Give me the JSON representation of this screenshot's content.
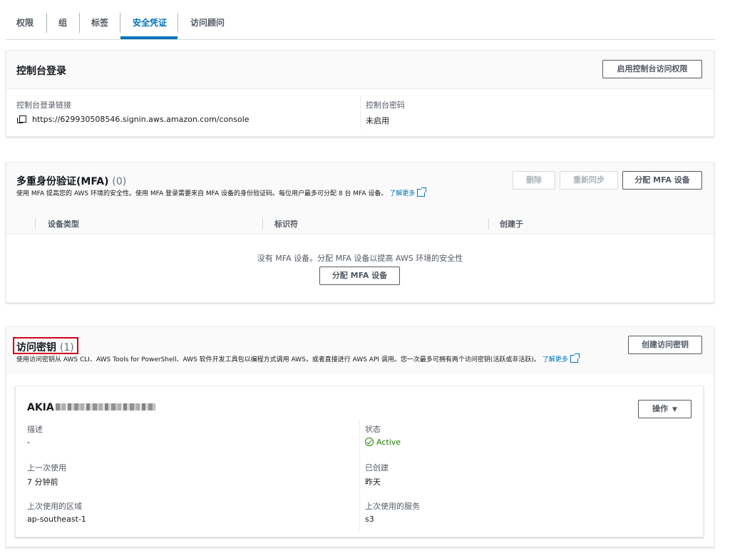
{
  "tabs": [
    {
      "label": "权限"
    },
    {
      "label": "组"
    },
    {
      "label": "标签"
    },
    {
      "label": "安全凭证"
    },
    {
      "label": "访问顾问"
    }
  ],
  "console": {
    "title": "控制台登录",
    "enable_button": "启用控制台访问权限",
    "link_label": "控制台登录链接",
    "link_value": "https://629930508546.signin.aws.amazon.com/console",
    "password_label": "控制台密码",
    "password_value": "未启用"
  },
  "mfa": {
    "title": "多重身份验证(MFA)",
    "count": "(0)",
    "description": "使用 MFA 提高您的 AWS 环境的安全性。使用 MFA 登录需要来自 MFA 设备的身份验证码。每位用户最多可分配 8 台 MFA 设备。",
    "learn_more": "了解更多",
    "delete_button": "删除",
    "resync_button": "重新同步",
    "assign_button": "分配 MFA 设备",
    "columns": [
      "设备类型",
      "标识符",
      "创建于"
    ],
    "empty_text": "没有 MFA 设备。分配 MFA 设备以提高 AWS 环境的安全性",
    "empty_assign_button": "分配 MFA 设备"
  },
  "access_keys": {
    "title": "访问密钥",
    "count": "(1)",
    "description": "使用访问密钥从 AWS CLI、AWS Tools for PowerShell、AWS 软件开发工具包以编程方式调用 AWS，或者直接进行 AWS API 调用。您一次最多可拥有两个访问密钥(活跃或非活跃)。",
    "learn_more": "了解更多",
    "create_button": "创建访问密钥",
    "key": {
      "id_prefix": "AKIA",
      "actions_button": "操作",
      "description_label": "描述",
      "description_value": "-",
      "status_label": "状态",
      "status_value": "Active",
      "last_used_label": "上一次使用",
      "last_used_value": "7 分钟前",
      "created_label": "已创建",
      "created_value": "昨天",
      "region_label": "上次使用的区域",
      "region_value": "ap-southeast-1",
      "service_label": "上次使用的服务",
      "service_value": "s3"
    }
  },
  "colors": {
    "accent": "#0073bb",
    "active": "#1d8102",
    "highlight": "#d0021b"
  }
}
